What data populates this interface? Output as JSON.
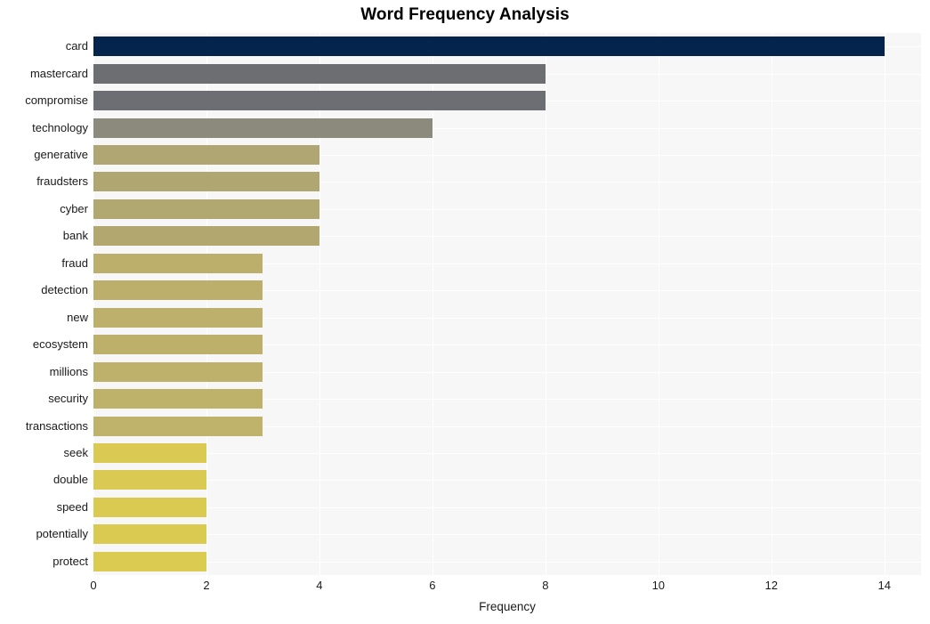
{
  "chart_data": {
    "type": "bar",
    "orientation": "horizontal",
    "title": "Word Frequency Analysis",
    "xlabel": "Frequency",
    "ylabel": "",
    "xlim": [
      0,
      14.65
    ],
    "xticks": [
      0,
      2,
      4,
      6,
      8,
      10,
      12,
      14
    ],
    "grid": true,
    "legend": "none",
    "categories": [
      "card",
      "mastercard",
      "compromise",
      "technology",
      "generative",
      "fraudsters",
      "cyber",
      "bank",
      "fraud",
      "detection",
      "new",
      "ecosystem",
      "millions",
      "security",
      "transactions",
      "seek",
      "double",
      "speed",
      "potentially",
      "protect"
    ],
    "values": [
      14,
      8,
      8,
      6,
      4,
      4,
      4,
      4,
      3,
      3,
      3,
      3,
      3,
      3,
      3,
      2,
      2,
      2,
      2,
      2
    ],
    "bar_colors": [
      "#04234d",
      "#6d6e72",
      "#6d6e73",
      "#8c8a7d",
      "#b0a673",
      "#b0a671",
      "#b1a770",
      "#b1a76f",
      "#bcaf6c",
      "#bcaf6c",
      "#bdb06c",
      "#bdb06b",
      "#beb16b",
      "#beb16a",
      "#bfb26a",
      "#dac953",
      "#dac952",
      "#dbca52",
      "#dbca51",
      "#dbcb51"
    ]
  },
  "style": {
    "plot_background": "#f7f7f7",
    "gridline_color": "#ffffff",
    "figure_background": "#ffffff",
    "text_color": "#1a1a1a",
    "title_color": "#000000"
  }
}
